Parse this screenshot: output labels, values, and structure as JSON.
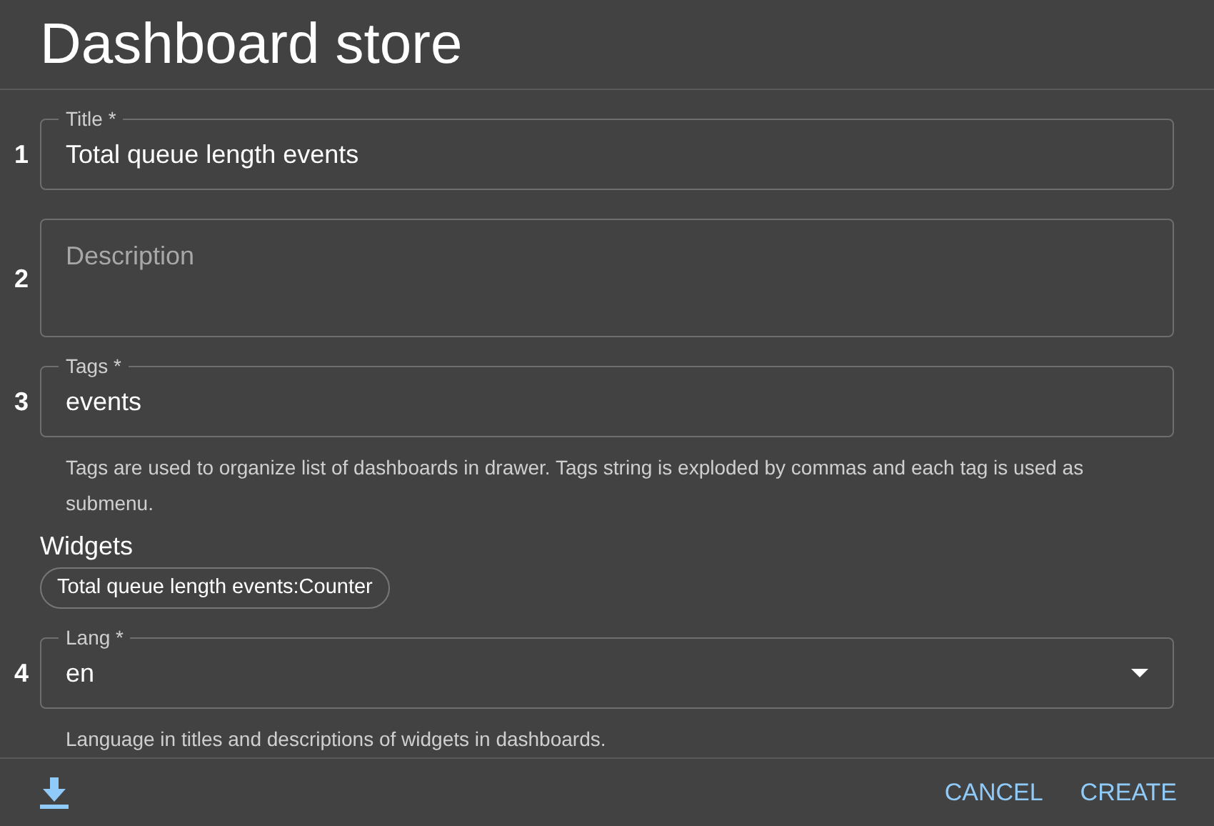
{
  "dialog_title": "Dashboard store",
  "fields": [
    {
      "kind": "text",
      "number": "1",
      "label": "Title *",
      "value": "Total queue length events"
    },
    {
      "kind": "textarea",
      "number": "2",
      "placeholder": "Description"
    },
    {
      "kind": "text",
      "number": "3",
      "label": "Tags *",
      "value": "events",
      "helper": "Tags are used to organize list of dashboards in drawer. Tags string is exploded by commas and each tag is used as submenu."
    },
    {
      "kind": "widgets",
      "heading": "Widgets",
      "chips": [
        "Total queue length events:Counter"
      ]
    },
    {
      "kind": "select",
      "number": "4",
      "label": "Lang *",
      "value": "en",
      "helper": "Language in titles and descriptions of widgets in dashboards."
    }
  ],
  "actions": [
    "CANCEL",
    "CREATE"
  ]
}
